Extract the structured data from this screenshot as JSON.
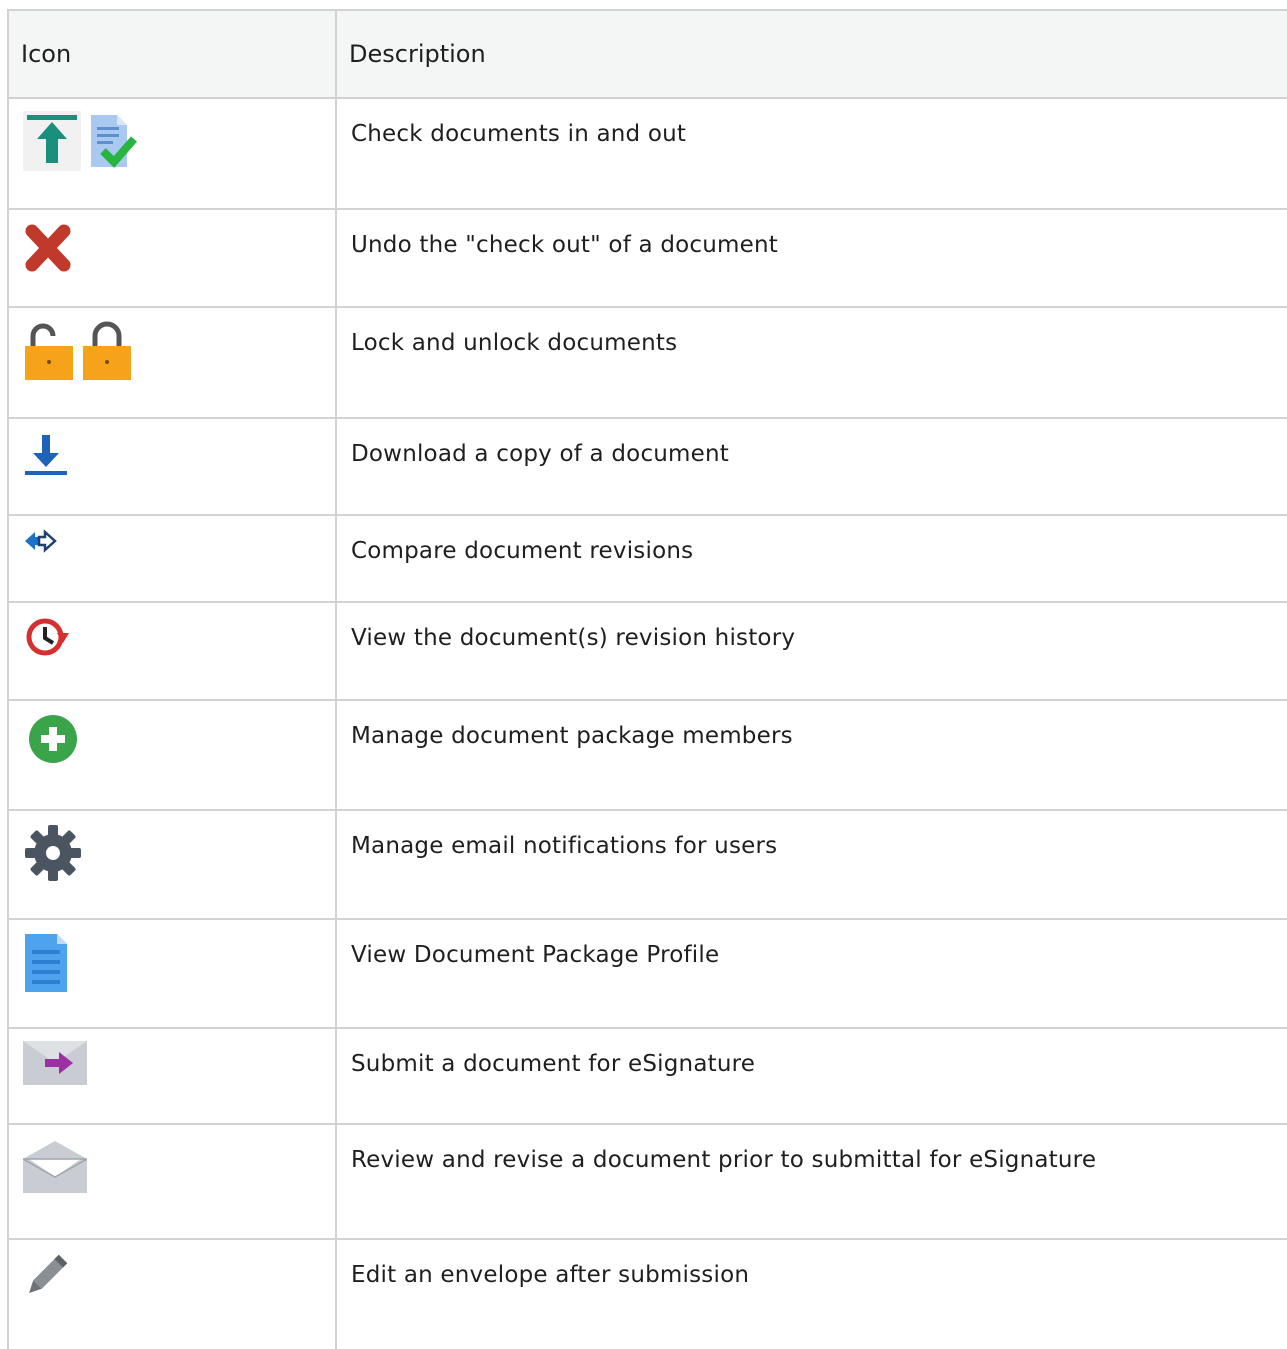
{
  "header": {
    "icon": "Icon",
    "description": "Description"
  },
  "rows": [
    {
      "icons": [
        "check-in-icon",
        "check-out-icon"
      ],
      "description": "Check documents in and out"
    },
    {
      "icons": [
        "undo-checkout-icon"
      ],
      "description": "Undo the \"check out\" of a document"
    },
    {
      "icons": [
        "unlock-icon",
        "lock-icon"
      ],
      "description": "Lock and unlock documents"
    },
    {
      "icons": [
        "download-icon"
      ],
      "description": "Download a copy of a document"
    },
    {
      "icons": [
        "compare-icon"
      ],
      "description": "Compare document revisions"
    },
    {
      "icons": [
        "revision-history-icon"
      ],
      "description": "View the document(s) revision history"
    },
    {
      "icons": [
        "add-member-icon"
      ],
      "description": "Manage document package members"
    },
    {
      "icons": [
        "gear-icon"
      ],
      "description": "Manage email notifications for users"
    },
    {
      "icons": [
        "document-profile-icon"
      ],
      "description": "View Document Package Profile"
    },
    {
      "icons": [
        "submit-esignature-icon"
      ],
      "description": "Submit a document for eSignature"
    },
    {
      "icons": [
        "open-envelope-icon"
      ],
      "description": "Review and revise a document prior to submittal for eSignature"
    },
    {
      "icons": [
        "pencil-icon"
      ],
      "description": "Edit an envelope after submission"
    }
  ]
}
